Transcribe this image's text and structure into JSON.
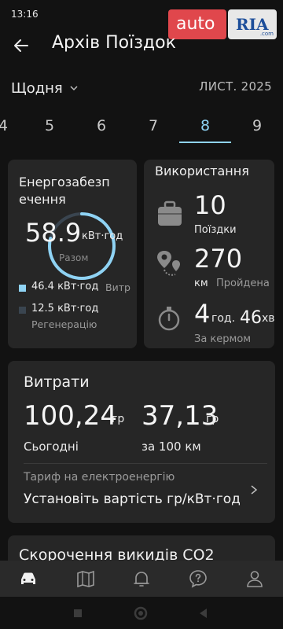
{
  "status": {
    "time": "13:16"
  },
  "watermark": {
    "auto": "auto",
    "ria": "RIA",
    "com": ".com"
  },
  "header": {
    "title": "Архів Поїздок"
  },
  "period": {
    "selected": "Щодня",
    "month": "ЛИСТ. 2025"
  },
  "days": {
    "d4": "4",
    "d5": "5",
    "d6": "6",
    "d7": "7",
    "d8": "8",
    "d9": "9",
    "active": "8"
  },
  "energy": {
    "title_line1": "Енергозабезп",
    "title_line2": "ечення",
    "total": "58.9",
    "unit": "кВт·год",
    "sub": "Разом",
    "consumed_value": "46.4 кВт·год",
    "consumed_label": "Витр",
    "regen_value": "12.5 кВт·год",
    "regen_label": "Регенерацію",
    "consumed_color": "#8fd3f4",
    "regen_color": "#3a4550"
  },
  "usage": {
    "title": "Використання",
    "trips_value": "10",
    "trips_label": "Поїздки",
    "distance_value": "270",
    "distance_unit": "км",
    "distance_label": "Пройдена",
    "time_value": "4",
    "time_unit": "год.",
    "time_value2": "46",
    "time_unit2": "хв",
    "time_label": "За кермом"
  },
  "costs": {
    "title": "Витрати",
    "today_value": "100,24",
    "today_unit": "гр",
    "today_label": "Сьогодні",
    "per100_value": "37,13",
    "per100_unit": "гр",
    "per100_label": "за 100 км",
    "tariff_label": "Тариф на електроенергію",
    "tariff_value": "Установіть вартість гр/кВт·год"
  },
  "co2": {
    "title": "Скорочення викидів CO2"
  },
  "nav": {
    "items": [
      "car-icon",
      "map-icon",
      "bell-icon",
      "help-icon",
      "profile-icon"
    ],
    "active": "car-icon"
  },
  "colors": {
    "accent": "#8fd3f4",
    "card": "#262626",
    "background": "#121212"
  }
}
